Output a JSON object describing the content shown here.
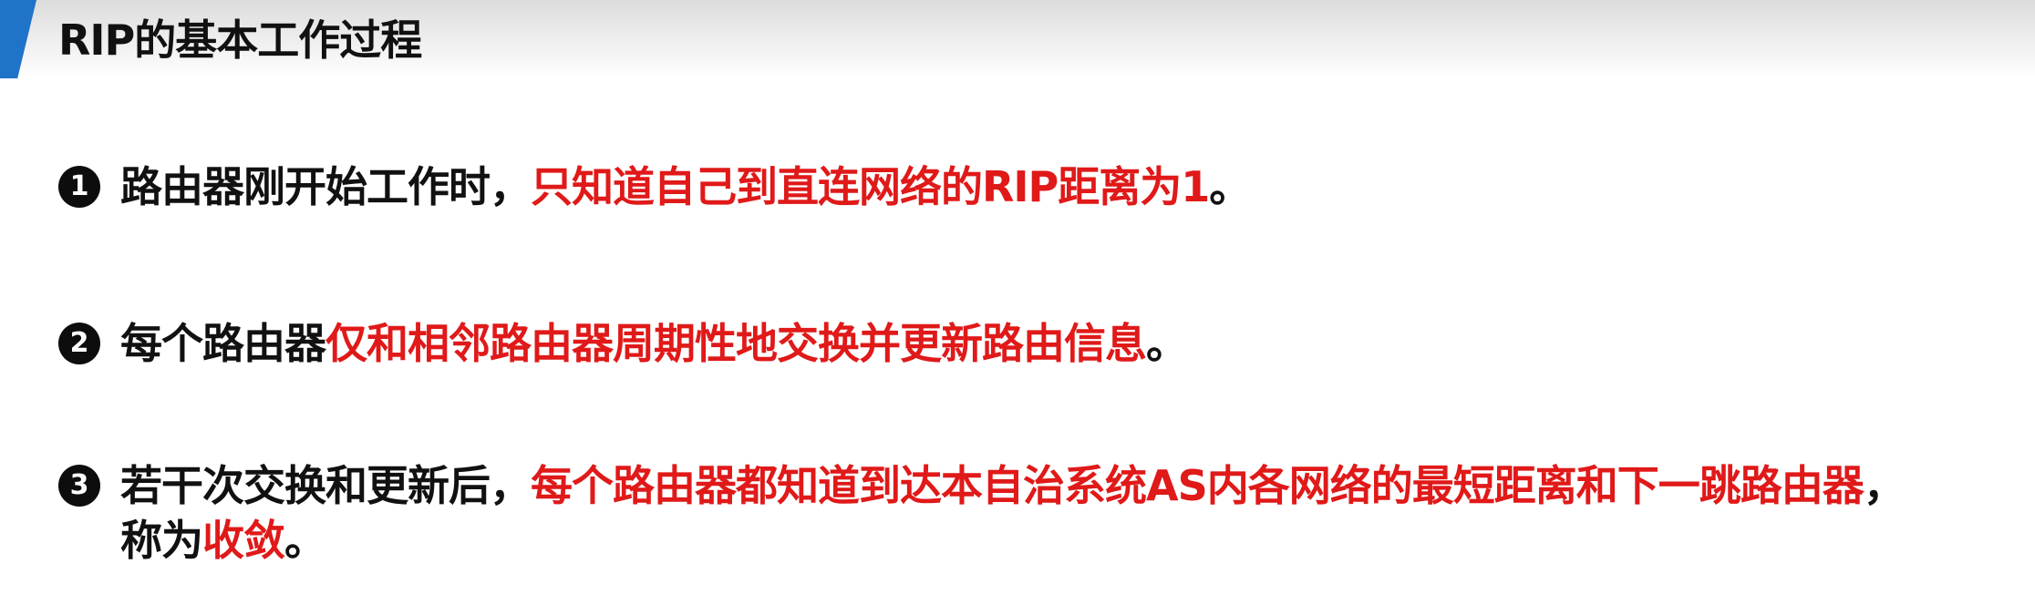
{
  "header": {
    "title": "RIP的基本工作过程"
  },
  "items": [
    {
      "marker": "1",
      "line1": [
        {
          "text": "路由器刚开始工作时，",
          "color": "#111111"
        },
        {
          "text": "只知道自己到直连网络的RIP距离为1",
          "color": "#e01919"
        },
        {
          "text": "。",
          "color": "#111111"
        }
      ]
    },
    {
      "marker": "2",
      "line1": [
        {
          "text": "每个路由器",
          "color": "#111111"
        },
        {
          "text": "仅和相邻路由器周期性地交换并更新路由信息",
          "color": "#e01919"
        },
        {
          "text": "。",
          "color": "#111111"
        }
      ]
    },
    {
      "marker": "3",
      "line1": [
        {
          "text": "若干次交换和更新后，",
          "color": "#111111"
        },
        {
          "text": "每个路由器都知道到达本自治系统AS内各网络的最短距离和下一跳路由器",
          "color": "#e01919"
        },
        {
          "text": "，",
          "color": "#111111"
        }
      ],
      "line2": [
        {
          "text": "称为",
          "color": "#111111"
        },
        {
          "text": "收敛",
          "color": "#e01919"
        },
        {
          "text": "。",
          "color": "#111111"
        }
      ]
    }
  ],
  "colors": {
    "accent": "#1f73c8",
    "highlight": "#e01919",
    "text": "#111111"
  },
  "icons": {
    "bullet_1": "number-1-circle-icon",
    "bullet_2": "number-2-circle-icon",
    "bullet_3": "number-3-circle-icon"
  }
}
